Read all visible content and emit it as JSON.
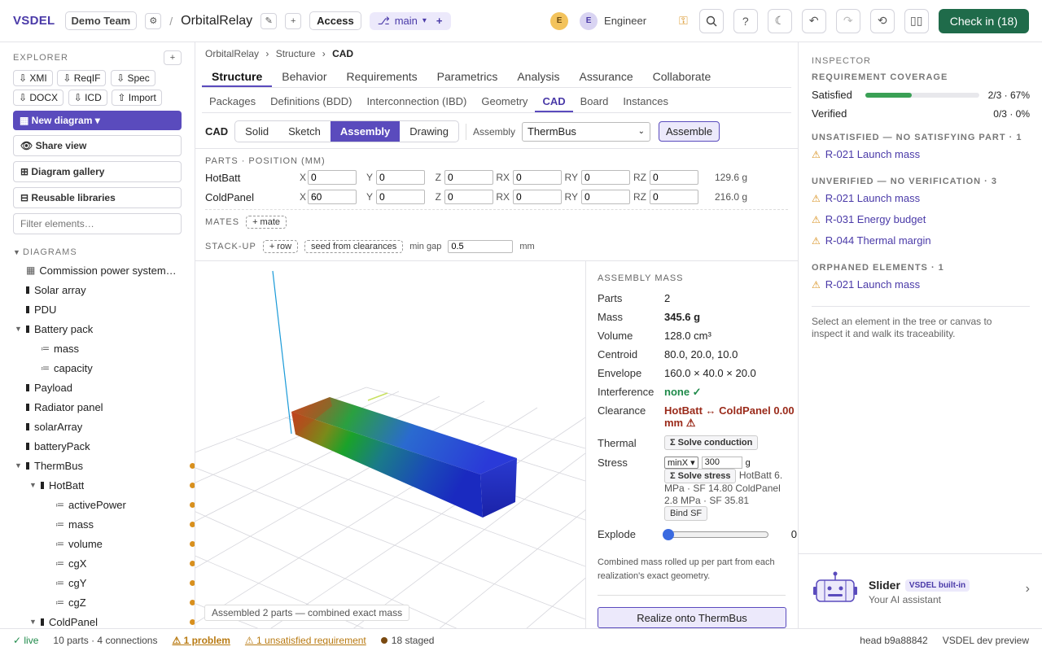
{
  "app": {
    "brand": "VSDEL",
    "team": "Demo Team",
    "project": "OrbitalRelay",
    "access": "Access",
    "branch": "main",
    "role": "Engineer",
    "avatars": [
      "E",
      "E"
    ],
    "checkin": "Check in (18)"
  },
  "explorer": {
    "title": "EXPLORER",
    "exports": [
      "XMI",
      "ReqIF",
      "Spec",
      "DOCX",
      "ICD",
      "Import"
    ],
    "new_diagram": "New diagram",
    "share_view": "Share view",
    "gallery": "Diagram gallery",
    "libraries": "Reusable libraries",
    "filter_placeholder": "Filter elements…",
    "diagrams_title": "DIAGRAMS",
    "tree": [
      {
        "label": "Commission power system…",
        "depth": 0,
        "kind": "diagram"
      },
      {
        "label": "Solar array",
        "depth": 0,
        "kind": "block"
      },
      {
        "label": "PDU",
        "depth": 0,
        "kind": "block"
      },
      {
        "label": "Battery pack",
        "depth": 0,
        "kind": "block",
        "expanded": true
      },
      {
        "label": "mass",
        "depth": 1,
        "kind": "attr"
      },
      {
        "label": "capacity",
        "depth": 1,
        "kind": "attr"
      },
      {
        "label": "Payload",
        "depth": 0,
        "kind": "block"
      },
      {
        "label": "Radiator panel",
        "depth": 0,
        "kind": "block"
      },
      {
        "label": "solarArray",
        "depth": 0,
        "kind": "block"
      },
      {
        "label": "batteryPack",
        "depth": 0,
        "kind": "block"
      },
      {
        "label": "ThermBus",
        "depth": 0,
        "kind": "block",
        "expanded": true,
        "dot": true
      },
      {
        "label": "HotBatt",
        "depth": 1,
        "kind": "block",
        "expanded": true,
        "dot": true
      },
      {
        "label": "activePower",
        "depth": 2,
        "kind": "attr",
        "dot": true
      },
      {
        "label": "mass",
        "depth": 2,
        "kind": "attr",
        "dot": true
      },
      {
        "label": "volume",
        "depth": 2,
        "kind": "attr",
        "dot": true
      },
      {
        "label": "cgX",
        "depth": 2,
        "kind": "attr",
        "dot": true
      },
      {
        "label": "cgY",
        "depth": 2,
        "kind": "attr",
        "dot": true
      },
      {
        "label": "cgZ",
        "depth": 2,
        "kind": "attr",
        "dot": true
      },
      {
        "label": "ColdPanel",
        "depth": 1,
        "kind": "block",
        "expanded": true,
        "dot": true
      }
    ]
  },
  "breadcrumb": [
    "OrbitalRelay",
    "Structure",
    "CAD"
  ],
  "tabs": [
    "Structure",
    "Behavior",
    "Requirements",
    "Parametrics",
    "Analysis",
    "Assurance",
    "Collaborate"
  ],
  "subtabs": [
    "Packages",
    "Definitions (BDD)",
    "Interconnection (IBD)",
    "Geometry",
    "CAD",
    "Board",
    "Instances"
  ],
  "cad": {
    "label": "CAD",
    "modes": [
      "Solid",
      "Sketch",
      "Assembly",
      "Drawing"
    ],
    "assembly_label": "Assembly",
    "assembly_value": "ThermBus",
    "assemble_button": "Assemble",
    "parts_title": "PARTS · POSITION (MM)",
    "axes": [
      "X",
      "Y",
      "Z",
      "RX",
      "RY",
      "RZ"
    ],
    "parts": [
      {
        "name": "HotBatt",
        "values": [
          "0",
          "0",
          "0",
          "0",
          "0",
          "0"
        ],
        "mass": "129.6 g"
      },
      {
        "name": "ColdPanel",
        "values": [
          "60",
          "0",
          "0",
          "0",
          "0",
          "0"
        ],
        "mass": "216.0 g"
      }
    ],
    "mates_title": "MATES",
    "mate_button": "+ mate",
    "stackup_title": "STACK-UP",
    "row_button": "+ row",
    "seed_button": "seed from clearances",
    "min_gap_label": "min gap",
    "min_gap_value": "0.5",
    "min_gap_unit": "mm",
    "viewport_status": "Assembled 2 parts — combined exact mass"
  },
  "mass": {
    "title": "ASSEMBLY MASS",
    "rows": {
      "parts": {
        "k": "Parts",
        "v": "2"
      },
      "mass": {
        "k": "Mass",
        "v": "345.6 g"
      },
      "volume": {
        "k": "Volume",
        "v": "128.0 cm³"
      },
      "centroid": {
        "k": "Centroid",
        "v": "80.0, 20.0, 10.0"
      },
      "envelope": {
        "k": "Envelope",
        "v": "160.0 × 40.0 × 20.0"
      },
      "interference": {
        "k": "Interference",
        "v": "none ✓"
      },
      "clearance": {
        "k": "Clearance",
        "v": "HotBatt ↔ ColdPanel 0.00 mm ⚠"
      }
    },
    "thermal_label": "Thermal",
    "thermal_button": "Σ Solve conduction",
    "stress_label": "Stress",
    "stress_axis": "minX",
    "stress_value": "300",
    "stress_unit": "g",
    "stress_button": "Σ Solve stress",
    "stress_result": "HotBatt 6. MPa · SF 14.80   ColdPanel 2.8 MPa · SF 35.81",
    "bind_sf": "Bind SF",
    "explode_label": "Explode",
    "explode_value": "0",
    "note": "Combined mass rolled up per part from each realization's exact geometry.",
    "realize_button": "Realize onto ThermBus"
  },
  "inspector": {
    "title": "INSPECTOR",
    "coverage_title": "REQUIREMENT COVERAGE",
    "satisfied": {
      "label": "Satisfied",
      "value": "2/3 · 67%",
      "fraction": 0.67
    },
    "verified": {
      "label": "Verified",
      "value": "0/3 · 0%",
      "fraction": 0
    },
    "unsatisfied_title": "UNSATISFIED — NO SATISFYING PART · 1",
    "unsatisfied": [
      "R-021 Launch mass"
    ],
    "unverified_title": "UNVERIFIED — NO VERIFICATION · 3",
    "unverified": [
      "R-021 Launch mass",
      "R-031 Energy budget",
      "R-044 Thermal margin"
    ],
    "orphaned_title": "ORPHANED ELEMENTS · 1",
    "orphaned": [
      "R-021 Launch mass"
    ],
    "hint": "Select an element in the tree or canvas to inspect it and walk its traceability."
  },
  "assistant": {
    "name": "Slider",
    "badge": "VSDEL built-in",
    "subtitle": "Your AI assistant"
  },
  "status": {
    "live": "✓ live",
    "counts": "10 parts · 4 connections",
    "problem": "⚠ 1 problem",
    "unsatisfied": "⚠ 1 unsatisfied requirement",
    "staged": "18 staged",
    "head": "head b9a88842",
    "env": "VSDEL dev preview"
  },
  "colors": {
    "accent": "#5a4bbd",
    "checkin": "#1f6b4a",
    "warn": "#d8901e",
    "danger": "#9a2a1a",
    "ok": "#1f8a4a"
  }
}
